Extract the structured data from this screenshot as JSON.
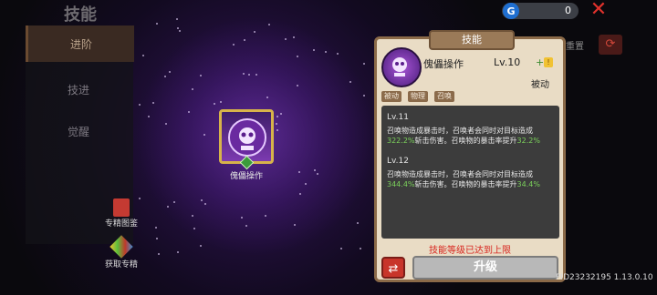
{
  "header": {
    "title": "技能"
  },
  "sidebar": {
    "tabs": [
      {
        "label": "进阶"
      },
      {
        "label": "技进"
      },
      {
        "label": "觉醒"
      }
    ],
    "buttons": [
      {
        "label": "专精图鉴"
      },
      {
        "label": "获取专精"
      }
    ]
  },
  "currency": {
    "value": "0",
    "icon": "gem-icon"
  },
  "reset": {
    "label": "重置"
  },
  "skill_node": {
    "label": "傀儡操作"
  },
  "panel": {
    "header": "技能",
    "skill_name": "傀儡操作",
    "level_text": "Lv.10",
    "level_bonus": "+ 2",
    "type": "被动",
    "tags": [
      "被动",
      "物理",
      "召唤"
    ],
    "levels": [
      {
        "title": "Lv.11",
        "line1": "召唤物造成暴击时，召唤者会同时对目标造成",
        "value1": "322.2%",
        "mid": "斩击伤害。召唤物的暴击率提升",
        "value2": "32.2%"
      },
      {
        "title": "Lv.12",
        "line1": "召唤物造成暴击时，召唤者会同时对目标造成",
        "value1": "344.4%",
        "mid": "斩击伤害。召唤物的暴击率提升",
        "value2": "34.4%"
      }
    ],
    "max_note": "技能等级已达到上限",
    "upgrade_label": "升级"
  },
  "footer": {
    "version": "PID23232195 1.13.0.10"
  },
  "colors": {
    "accent": "#d7b34a",
    "panel": "#e9dcc5",
    "highlight": "#7bd15b",
    "alert": "#d8261f"
  }
}
